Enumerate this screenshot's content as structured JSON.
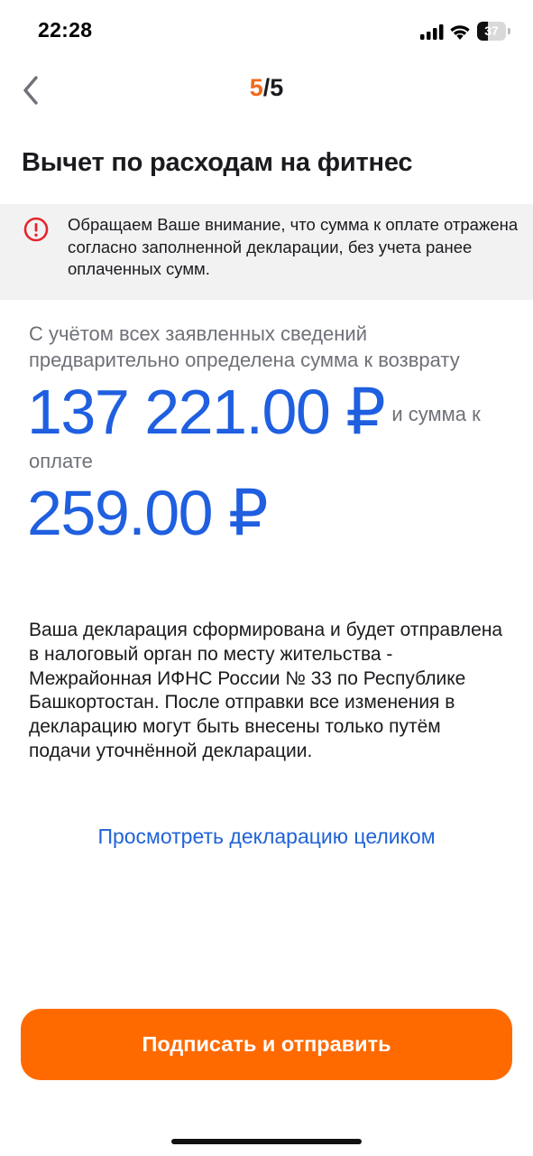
{
  "status_bar": {
    "time": "22:28",
    "battery": "37",
    "battery_level": 0.37
  },
  "header": {
    "step_current": "5",
    "step_separator": "/",
    "step_total": "5",
    "title": "Вычет по расходам на фитнес"
  },
  "notice": {
    "text": "Обращаем Ваше внимание, что сумма к оплате отражена согласно заполненной декларации, без учета ранее оплаченных сумм."
  },
  "summary": {
    "intro": "С учётом всех заявленных сведений предварительно определена сумма к возврату",
    "refund_amount": "137 221.00 ₽",
    "refund_suffix_part1": "и сумма к",
    "refund_suffix_part2": "оплате",
    "payment_amount": "259.00 ₽"
  },
  "declaration": {
    "text": "Ваша декларация сформирована и будет отправлена в налоговый орган по месту жительства - Межрайонная ИФНС России № 33 по Республике Башкортостан. После отправки все изменения в декларацию могут быть внесены только путём подачи уточнённой декларации.",
    "view_link": "Просмотреть декларацию целиком"
  },
  "actions": {
    "sign_and_send": "Подписать и отправить"
  },
  "colors": {
    "accent_orange": "#ff6a00",
    "amount_blue": "#1f5fe0",
    "link_blue": "#1f63d6",
    "warning_red": "#e5242a"
  },
  "icons": {
    "back": "chevron-left-icon",
    "notice": "alert-circle-icon"
  }
}
